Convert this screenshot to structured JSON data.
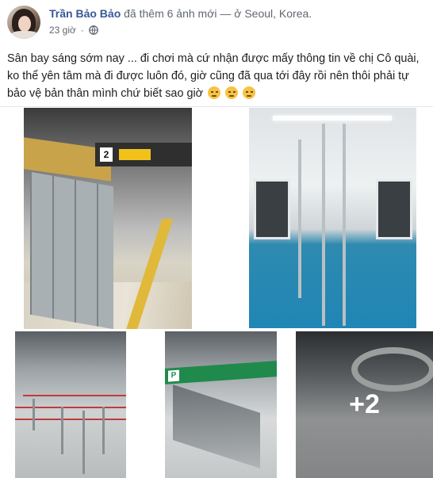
{
  "post": {
    "author": "Trần Bảo Bảo",
    "action": "đã thêm 6 ảnh mới — ở Seoul, Korea.",
    "time": "23 giờ",
    "privacy_icon": "globe-icon",
    "body": "Sân bay sáng sớm nay ... đi chơi mà cứ nhận được mấy thông tin về chị Cô quài, ko thể yên tâm mà đi được luôn đó, giờ cũng đã qua tới đây rồi nên thôi phải tự bảo vệ bản thân mình chứ biết sao giờ",
    "emoji_icon": "pensive-face-icon",
    "extra_photos_label": "+2"
  },
  "photos": {
    "p1_sign_number": "2",
    "p4_sign_letter": "P"
  },
  "colors": {
    "author": "#385898",
    "meta": "#616770",
    "text": "#1c1e21"
  }
}
